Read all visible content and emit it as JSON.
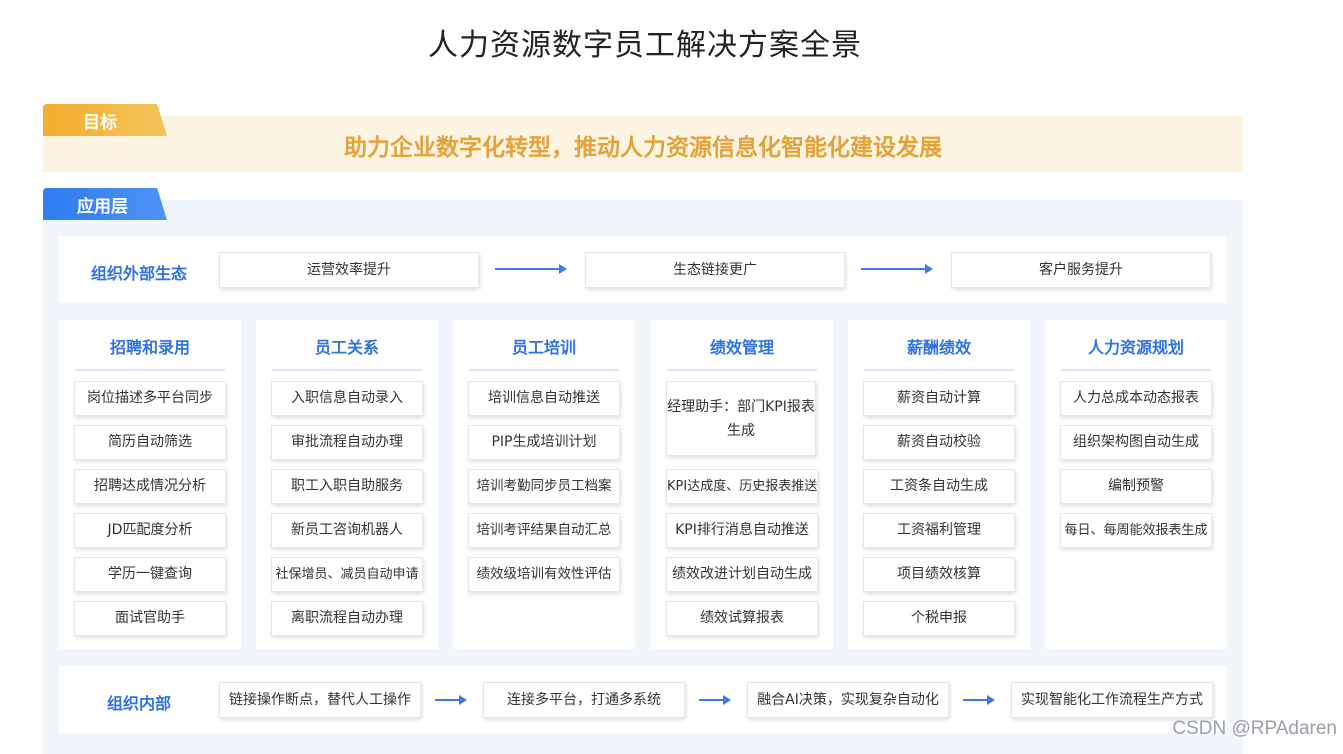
{
  "title": "人力资源数字员工解决方案全景",
  "goal": {
    "tag": "目标",
    "text": "助力企业数字化转型，推动人力资源信息化智能化建设发展"
  },
  "app_layer": {
    "tag": "应用层"
  },
  "external": {
    "label": "组织外部生态",
    "steps": [
      "运营效率提升",
      "生态链接更广",
      "客户服务提升"
    ]
  },
  "columns": [
    {
      "title": "招聘和录用",
      "items": [
        "岗位描述多平台同步",
        "简历自动筛选",
        "招聘达成情况分析",
        "JD匹配度分析",
        "学历一键查询",
        "面试官助手"
      ]
    },
    {
      "title": "员工关系",
      "items": [
        "入职信息自动录入",
        "审批流程自动办理",
        "职工入职自助服务",
        "新员工咨询机器人",
        "社保增员、减员自动申请",
        "离职流程自动办理"
      ]
    },
    {
      "title": "员工培训",
      "items": [
        "培训信息自动推送",
        "PIP生成培训计划",
        "培训考勤同步员工档案",
        "培训考评结果自动汇总",
        "绩效级培训有效性评估"
      ]
    },
    {
      "title": "绩效管理",
      "items": [
        "经理助手：部门KPI报表生成",
        "KPI达成度、历史报表推送",
        "KPI排行消息自动推送",
        "绩效改进计划自动生成",
        "绩效试算报表"
      ]
    },
    {
      "title": "薪酬绩效",
      "items": [
        "薪资自动计算",
        "薪资自动校验",
        "工资条自动生成",
        "工资福利管理",
        "项目绩效核算",
        "个税申报"
      ]
    },
    {
      "title": "人力资源规划",
      "items": [
        "人力总成本动态报表",
        "组织架构图自动生成",
        "编制预警",
        "每日、每周能效报表生成"
      ]
    }
  ],
  "internal": {
    "label": "组织内部",
    "steps": [
      "链接操作断点，替代人工操作",
      "连接多平台，打通多系统",
      "融合AI决策，实现复杂自动化",
      "实现智能化工作流程生产方式"
    ]
  },
  "watermark": "CSDN @RPAdaren",
  "colors": {
    "accent_blue": "#2f72e6",
    "goal_gold": "#e3a23a",
    "panel_bg": "#f1f6fd",
    "goal_bg": "#fdf4e1"
  }
}
